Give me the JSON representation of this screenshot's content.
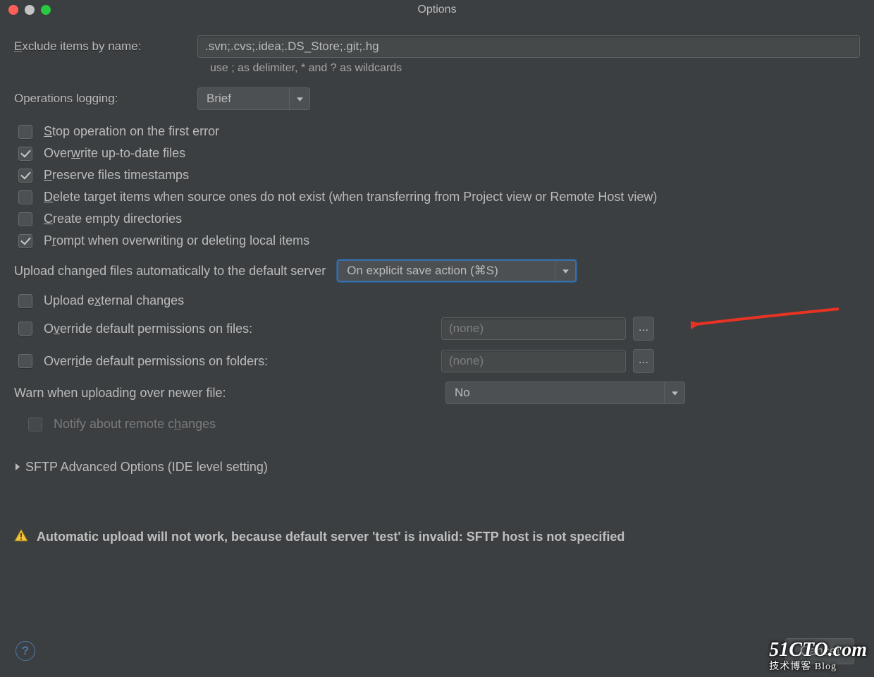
{
  "window": {
    "title": "Options"
  },
  "traffic": {
    "close": "#ff5f57",
    "min": "#c4c4c4",
    "max": "#28c840"
  },
  "exclude": {
    "label": "Exclude items by name:",
    "value": ".svn;.cvs;.idea;.DS_Store;.git;.hg",
    "hint": "use ; as delimiter, * and ? as wildcards"
  },
  "ops_logging": {
    "label": "Operations logging:",
    "value": "Brief"
  },
  "checks": {
    "stop_first_error": {
      "checked": false,
      "pre": "",
      "u": "S",
      "post": "top operation on the first error"
    },
    "overwrite_uptodate": {
      "checked": true,
      "pre": "Over",
      "u": "w",
      "post": "rite up-to-date files"
    },
    "preserve_ts": {
      "checked": true,
      "pre": "",
      "u": "P",
      "post": "reserve files timestamps"
    },
    "delete_target": {
      "checked": false,
      "pre": "",
      "u": "D",
      "post": "elete target items when source ones do not exist (when transferring from Project view or Remote Host view)"
    },
    "create_empty": {
      "checked": false,
      "pre": "",
      "u": "C",
      "post": "reate empty directories"
    },
    "prompt_overwrite": {
      "checked": true,
      "pre": "P",
      "u": "r",
      "post": "ompt when overwriting or deleting local items"
    },
    "upload_external": {
      "checked": false,
      "pre": "Upload e",
      "u": "x",
      "post": "ternal changes"
    },
    "override_files": {
      "checked": false,
      "pre": "O",
      "u": "v",
      "post": "erride default permissions on files:"
    },
    "override_folders": {
      "checked": false,
      "pre": "Overr",
      "u": "i",
      "post": "de default permissions on folders:"
    },
    "notify_remote": {
      "checked": false,
      "pre": "Notify about remote c",
      "u": "h",
      "post": "anges"
    }
  },
  "auto_upload": {
    "label": "Upload changed files automatically to the default server",
    "value": "On explicit save action (⌘S)"
  },
  "perm_files_value": "(none)",
  "perm_folders_value": "(none)",
  "dots": "...",
  "warn_newer": {
    "label": "Warn when uploading over newer file:",
    "value": "No"
  },
  "expander": "SFTP Advanced Options (IDE level setting)",
  "warning_text": "Automatic upload will not work, because default server 'test' is invalid: SFTP host is not specified",
  "buttons": {
    "cancel": "Cancel",
    "help": "?"
  },
  "watermark": {
    "big": "51CTO.com",
    "sm": "技术博客      Blog"
  }
}
